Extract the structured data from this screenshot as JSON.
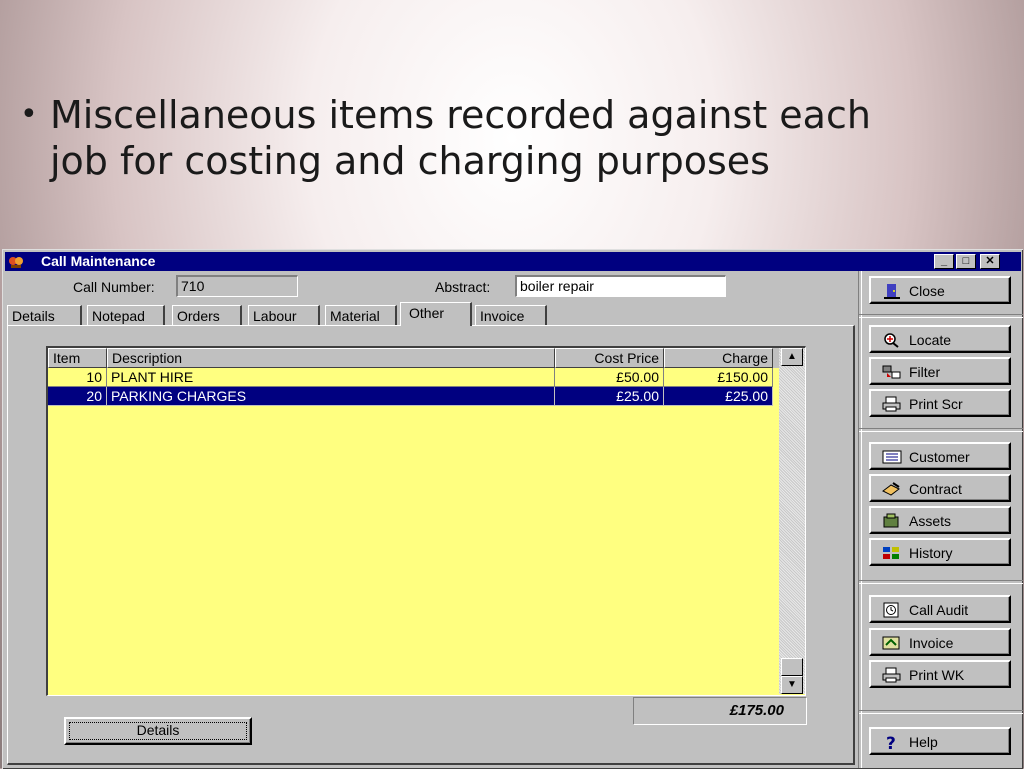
{
  "slide": {
    "bullet_symbol": "•",
    "bullet_text": "Miscellaneous items recorded against each job for costing and charging purposes"
  },
  "window": {
    "title": "Call Maintenance",
    "buttons": {
      "minimize": "_",
      "maximize": "□",
      "close": "✕"
    }
  },
  "form": {
    "call_number_label": "Call Number:",
    "call_number_value": "710",
    "abstract_label": "Abstract:",
    "abstract_value": "boiler repair"
  },
  "tabs": [
    {
      "label": "Details"
    },
    {
      "label": "Notepad"
    },
    {
      "label": "Orders"
    },
    {
      "label": "Labour"
    },
    {
      "label": "Material"
    },
    {
      "label": "Other",
      "active": true
    },
    {
      "label": "Invoice"
    }
  ],
  "grid": {
    "columns": [
      "Item",
      "Description",
      "Cost Price",
      "Charge"
    ],
    "rows": [
      {
        "item": "10",
        "description": "PLANT HIRE",
        "cost_price": "£50.00",
        "charge": "£150.00",
        "selected": false
      },
      {
        "item": "20",
        "description": "PARKING CHARGES",
        "cost_price": "£25.00",
        "charge": "£25.00",
        "selected": true
      }
    ],
    "total": "£175.00"
  },
  "details_button": "Details",
  "side_buttons": {
    "close": "Close",
    "locate": "Locate",
    "filter": "Filter",
    "print_scr": "Print Scr",
    "customer": "Customer",
    "contract": "Contract",
    "assets": "Assets",
    "history": "History",
    "call_audit": "Call Audit",
    "invoice": "Invoice",
    "print_wk": "Print WK",
    "help": "Help"
  },
  "colors": {
    "title_bar": "#000080",
    "grid_background": "#ffff80",
    "selection": "#000080",
    "window_face": "#c0c0c0"
  }
}
